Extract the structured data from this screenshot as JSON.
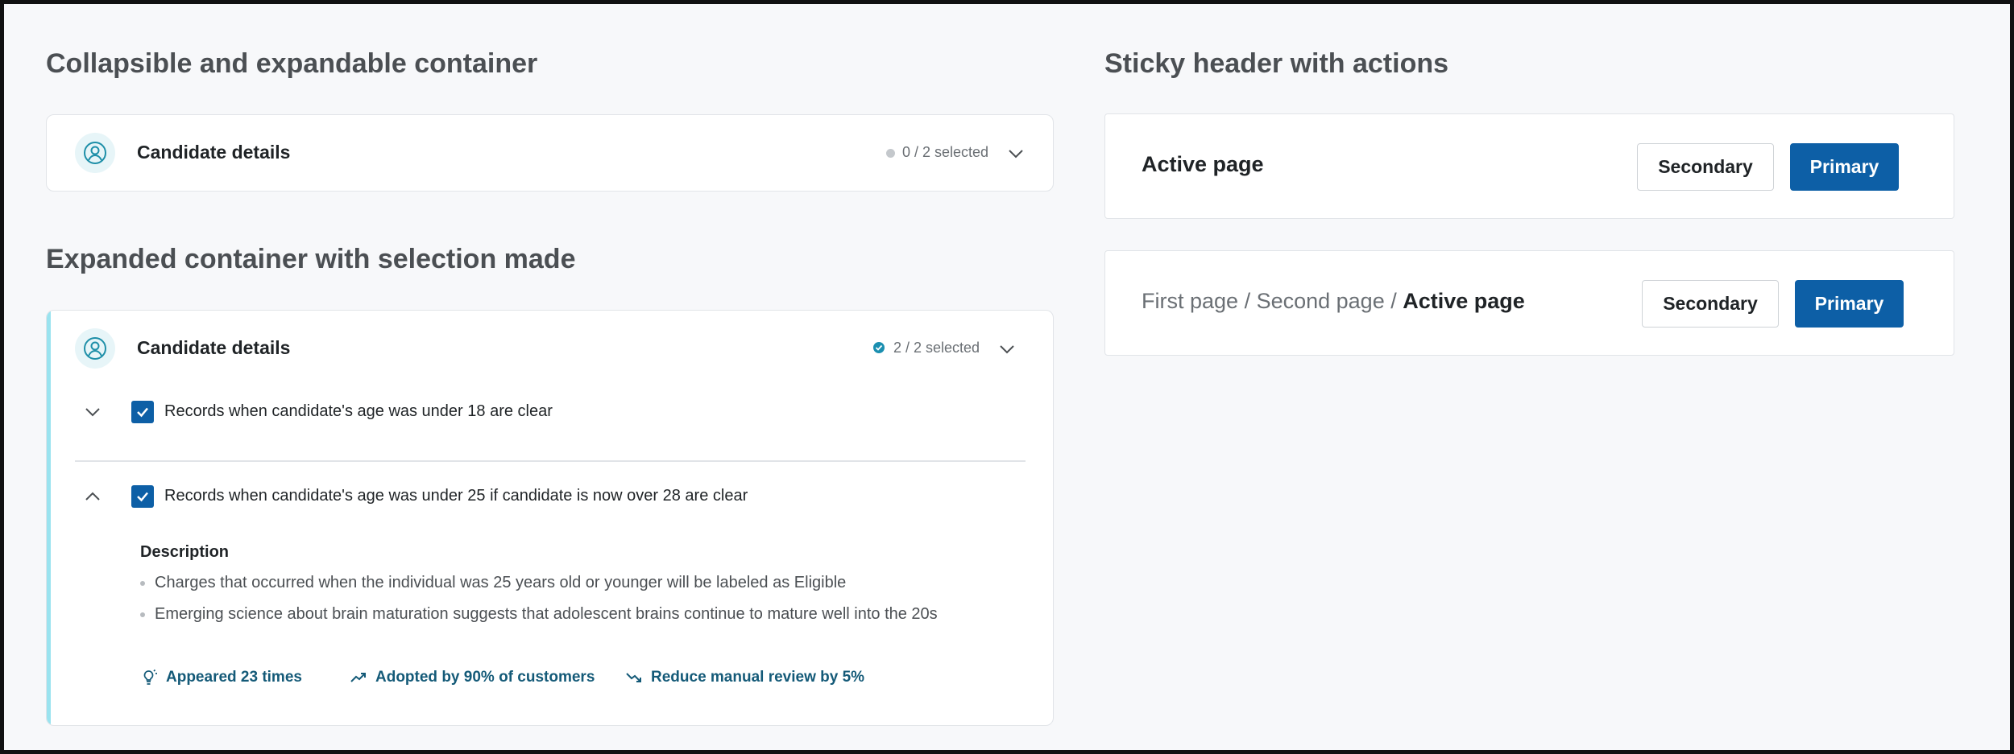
{
  "left": {
    "section1_title": "Collapsible and expandable container",
    "collapsed_card": {
      "title": "Candidate details",
      "selection": "0 / 2 selected"
    },
    "section2_title": "Expanded container with selection made",
    "expanded_card": {
      "title": "Candidate details",
      "selection": "2 / 2 selected",
      "rows": [
        {
          "label": "Records when candidate's age was under 18 are clear",
          "checked": true,
          "expanded": false
        },
        {
          "label": "Records when candidate's age was under 25 if candidate is now over 28 are clear",
          "checked": true,
          "expanded": true
        }
      ],
      "description_title": "Description",
      "description_items": [
        "Charges that occurred when the individual was 25 years old or younger will be labeled as Eligible",
        "Emerging science about brain maturation suggests that adolescent brains continue to mature well into the 20s"
      ],
      "stats": [
        {
          "icon": "lightbulb-icon",
          "text": "Appeared 23 times"
        },
        {
          "icon": "trending-up-icon",
          "text": "Adopted by 90% of customers"
        },
        {
          "icon": "trending-down-icon",
          "text": "Reduce manual review by 5%"
        }
      ]
    }
  },
  "right": {
    "section_title": "Sticky header with actions",
    "header1": {
      "page": "Active page",
      "secondary": "Secondary",
      "primary": "Primary"
    },
    "header2": {
      "crumb1": "First page",
      "crumb2": "Second page",
      "separator": " / ",
      "active": "Active page",
      "secondary": "Secondary",
      "primary": "Primary"
    }
  },
  "colors": {
    "primary": "#0d5fa6",
    "accent": "#9ae3ef",
    "stat_text": "#145a78",
    "selected_badge": "#1b8fb0"
  }
}
